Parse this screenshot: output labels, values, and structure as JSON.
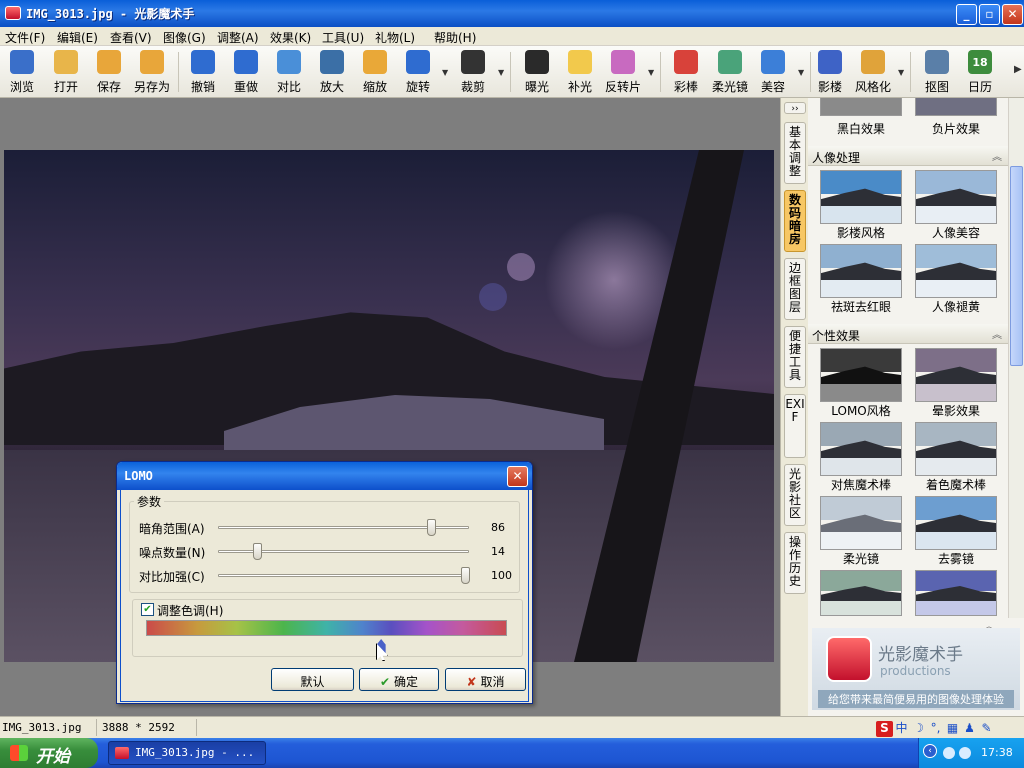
{
  "window": {
    "title": "IMG_3013.jpg - 光影魔术手",
    "min_label": "_",
    "max_label": "▫",
    "close_label": "✕"
  },
  "menu": [
    "文件(F)",
    "编辑(E)",
    "查看(V)",
    "图像(G)",
    "调整(A)",
    "效果(K)",
    "工具(U)",
    "礼物(L)",
    "帮助(H)"
  ],
  "toolbar": [
    {
      "name": "browse",
      "label": "浏览",
      "icon": "eye-icon",
      "color": "#3a6fc9"
    },
    {
      "name": "open",
      "label": "打开",
      "icon": "folder-icon",
      "color": "#e8b54a"
    },
    {
      "name": "save",
      "label": "保存",
      "icon": "floppy-icon",
      "color": "#e8a63a"
    },
    {
      "name": "save-as",
      "label": "另存为",
      "icon": "floppy-icon",
      "color": "#e8a63a"
    },
    {
      "name": "undo",
      "label": "撤销",
      "icon": "undo-icon",
      "color": "#2f6cd0"
    },
    {
      "name": "redo",
      "label": "重做",
      "icon": "redo-icon",
      "color": "#2f6cd0"
    },
    {
      "name": "compare",
      "label": "对比",
      "icon": "compare-icon",
      "color": "#4a8fd8"
    },
    {
      "name": "zoom-in",
      "label": "放大",
      "icon": "magnifier-icon",
      "color": "#3b6fa6"
    },
    {
      "name": "resize",
      "label": "缩放",
      "icon": "resize-icon",
      "color": "#e9a838"
    },
    {
      "name": "rotate",
      "label": "旋转",
      "icon": "rotate-icon",
      "color": "#2f6cd0"
    },
    {
      "name": "crop",
      "label": "裁剪",
      "icon": "crop-icon",
      "color": "#333333"
    },
    {
      "name": "exposure",
      "label": "曝光",
      "icon": "sun-icon",
      "color": "#2a2a2a"
    },
    {
      "name": "fill-light",
      "label": "补光",
      "icon": "bulb-icon",
      "color": "#f2c94c"
    },
    {
      "name": "reversal",
      "label": "反转片",
      "icon": "picture-icon",
      "color": "#c86ac0"
    },
    {
      "name": "magic-wand",
      "label": "彩棒",
      "icon": "wand-icon",
      "color": "#d8423a"
    },
    {
      "name": "soft-lens",
      "label": "柔光镜",
      "icon": "landscape-icon",
      "color": "#4aa37a"
    },
    {
      "name": "beauty",
      "label": "美容",
      "icon": "face-icon",
      "color": "#3c7fd8"
    },
    {
      "name": "shadow",
      "label": "影楼",
      "icon": "shadow-icon",
      "color": "#3e63c6"
    },
    {
      "name": "stylize",
      "label": "风格化",
      "icon": "style-icon",
      "color": "#e0a33a"
    },
    {
      "name": "cutout",
      "label": "抠图",
      "icon": "cutout-icon",
      "color": "#5a7fa8"
    },
    {
      "name": "calendar",
      "label": "日历",
      "icon": "calendar-icon",
      "color": "#3d8c3d"
    }
  ],
  "calendar_day": "18",
  "side_tabs": [
    "基本调整",
    "数码暗房",
    "边框图层",
    "便捷工具",
    "EXIF",
    "光影社区",
    "操作历史"
  ],
  "panel": {
    "top_labels": [
      "黑白效果",
      "负片效果"
    ],
    "sections": [
      {
        "title": "人像处理",
        "items": [
          "影楼风格",
          "人像美容",
          "祛斑去红眼",
          "人像褪黄"
        ]
      },
      {
        "title": "个性效果",
        "items": [
          "LOMO风格",
          "晕影效果",
          "对焦魔术棒",
          "着色魔术棒",
          "柔光镜",
          "去雾镜"
        ]
      }
    ],
    "brand_name": "光影魔术手",
    "brand_sub": "productions",
    "brand_slogan": "给您带来最简便易用的图像处理体验"
  },
  "dialog": {
    "title": "LOMO",
    "group_label": "参数",
    "params": [
      {
        "label": "暗角范围(A)",
        "value": 86,
        "fraction": 0.86
      },
      {
        "label": "噪点数量(N)",
        "value": 14,
        "fraction": 0.14
      },
      {
        "label": "对比加强(C)",
        "value": 100,
        "fraction": 1.0
      }
    ],
    "hue_label": "调整色调(H)",
    "hue_checked": true,
    "hue_fraction": 0.65,
    "buttons": {
      "default": "默认",
      "ok": "确定",
      "cancel": "取消"
    }
  },
  "status": {
    "filename": "IMG_3013.jpg",
    "dimensions": "3888 * 2592"
  },
  "taskbar": {
    "start": "开始",
    "task": "IMG_3013.jpg - ...",
    "clock": "17:38"
  }
}
